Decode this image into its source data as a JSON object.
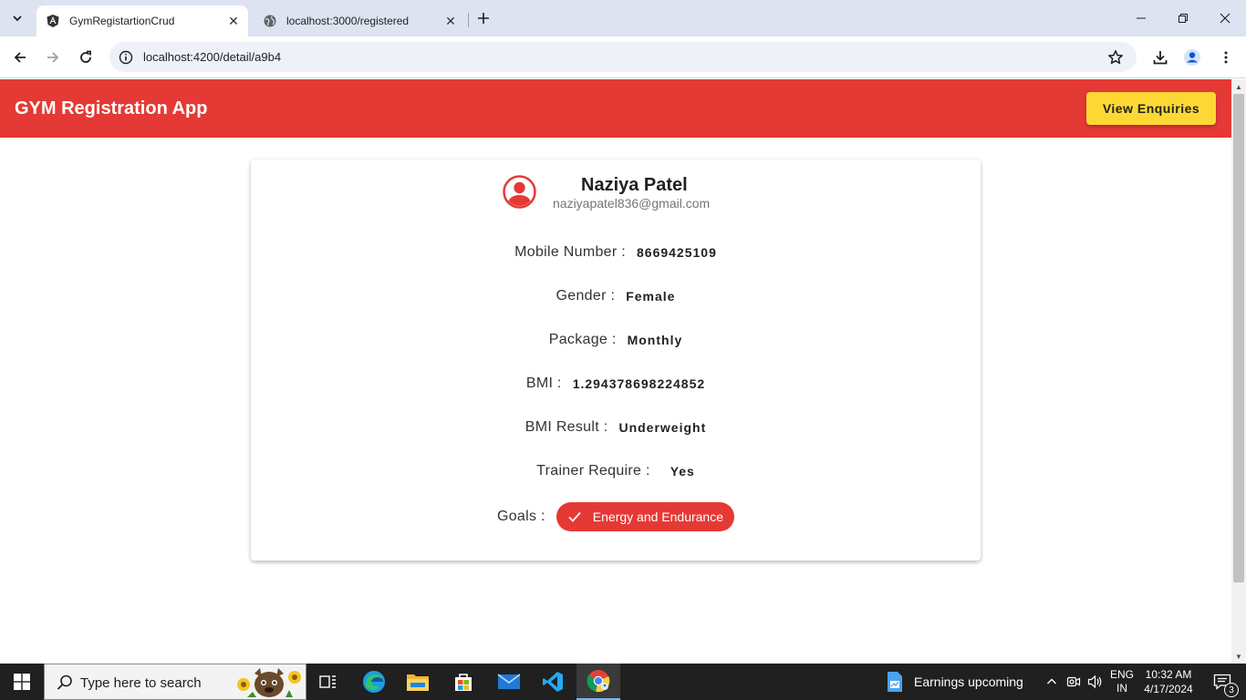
{
  "browser": {
    "tabs": [
      {
        "title": "GymRegistartionCrud",
        "active": true
      },
      {
        "title": "localhost:3000/registered",
        "active": false
      }
    ],
    "url": "localhost:4200/detail/a9b4"
  },
  "app": {
    "brand": "GYM Registration App",
    "view_enquiries_label": "View Enquiries",
    "primary_color": "#e53935",
    "accent_color": "#fdd835"
  },
  "profile": {
    "name": "Naziya Patel",
    "email": "naziyapatel836@gmail.com",
    "fields": {
      "mobile": {
        "label": "Mobile Number :",
        "value": "8669425109"
      },
      "gender": {
        "label": "Gender :",
        "value": "Female"
      },
      "package": {
        "label": "Package :",
        "value": "Monthly"
      },
      "bmi": {
        "label": "BMI :",
        "value": "1.294378698224852"
      },
      "bmi_result": {
        "label": "BMI Result :",
        "value": "Underweight"
      },
      "trainer": {
        "label": "Trainer Require :",
        "value": "Yes"
      },
      "goals": {
        "label": "Goals :",
        "chips": [
          "Energy and Endurance"
        ]
      }
    }
  },
  "taskbar": {
    "search_placeholder": "Type here to search",
    "news": "Earnings upcoming",
    "lang_line1": "ENG",
    "lang_line2": "IN",
    "time": "10:32 AM",
    "date": "4/17/2024",
    "notification_count": "3"
  }
}
